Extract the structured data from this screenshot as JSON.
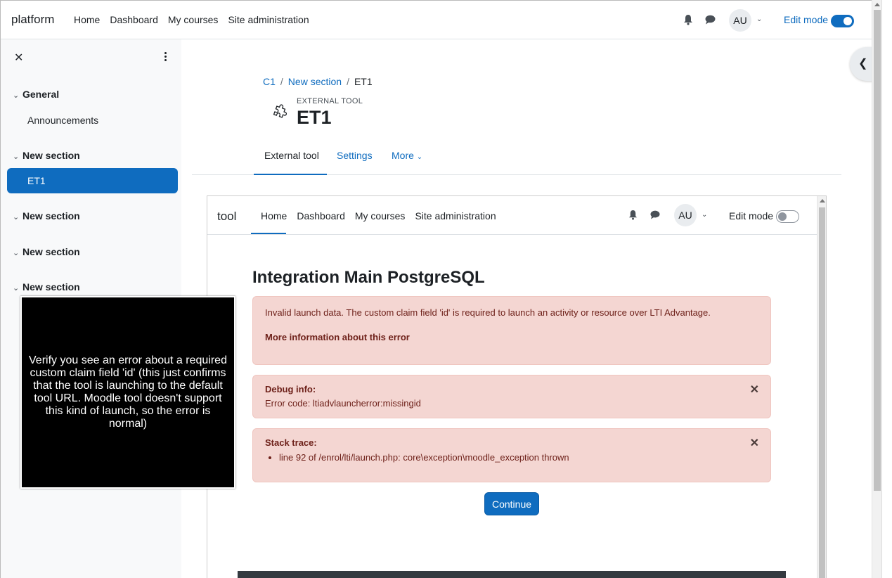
{
  "navbar": {
    "brand": "platform",
    "links": [
      "Home",
      "Dashboard",
      "My courses",
      "Site administration"
    ],
    "avatar": "AU",
    "edit_mode_label": "Edit mode",
    "edit_mode_on": true
  },
  "drawer": {
    "sections": [
      {
        "title": "General",
        "items": [
          "Announcements"
        ]
      },
      {
        "title": "New section",
        "items": [
          "ET1"
        ]
      },
      {
        "title": "New section",
        "items": []
      },
      {
        "title": "New section",
        "items": []
      },
      {
        "title": "New section",
        "items": []
      }
    ],
    "active_item": "ET1"
  },
  "overlay": {
    "text": "Verify you see an error about a required custom claim field 'id' (this just confirms that the tool is launching to the default tool URL. Moodle tool doesn't support this kind of launch, so the error is normal)"
  },
  "header": {
    "breadcrumb": [
      "C1",
      "New section",
      "ET1"
    ],
    "overtitle": "EXTERNAL TOOL",
    "title": "ET1"
  },
  "tabs": {
    "active": "External tool",
    "settings": "Settings",
    "more": "More"
  },
  "iframe": {
    "brand": "tool",
    "links": [
      "Home",
      "Dashboard",
      "My courses",
      "Site administration"
    ],
    "avatar": "AU",
    "edit_mode_label": "Edit mode",
    "edit_mode_on": false,
    "heading": "Integration Main PostgreSQL",
    "error_message": "Invalid launch data. The custom claim field 'id' is required to launch an activity or resource over LTI Advantage.",
    "more_info": "More information about this error",
    "debug_title": "Debug info:",
    "debug_text": "Error code: ltiadvlauncherror:missingid",
    "stack_title": "Stack trace:",
    "stack_line": "line 92 of /enrol/lti/launch.php: core\\exception\\moodle_exception thrown",
    "continue_label": "Continue"
  },
  "colors": {
    "primary": "#0f6cbf",
    "alert_bg": "#f4d6d2",
    "alert_text": "#6e211a"
  }
}
